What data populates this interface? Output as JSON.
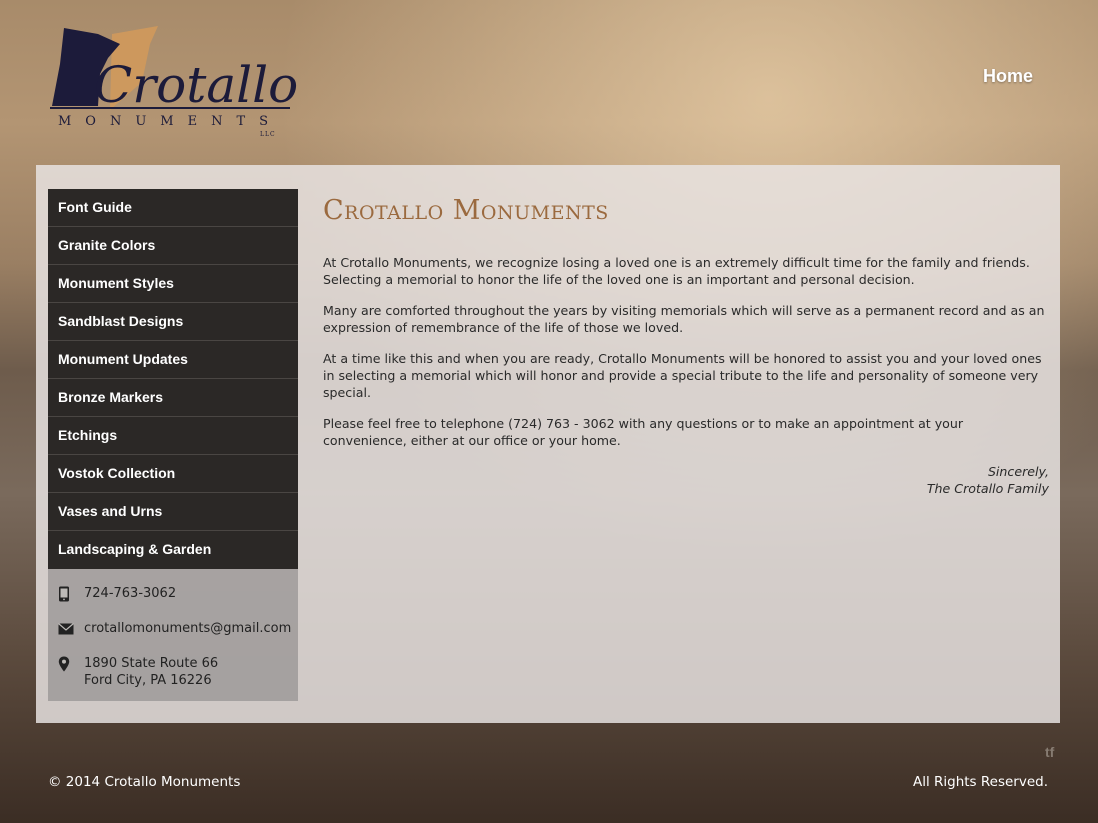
{
  "header": {
    "logo_main": "Crotallo",
    "logo_sub": "MONUMENTS",
    "logo_llc": "LLC",
    "nav_home": "Home"
  },
  "sidebar": {
    "items": [
      {
        "label": "Font Guide"
      },
      {
        "label": "Granite Colors"
      },
      {
        "label": "Monument Styles"
      },
      {
        "label": "Sandblast Designs"
      },
      {
        "label": "Monument Updates"
      },
      {
        "label": "Bronze Markers"
      },
      {
        "label": "Etchings"
      },
      {
        "label": "Vostok Collection"
      },
      {
        "label": "Vases and Urns"
      },
      {
        "label": "Landscaping & Garden"
      }
    ],
    "contact": {
      "phone": "724-763-3062",
      "email": "crotallomonuments@gmail.com",
      "address_line1": "1890 State Route 66",
      "address_line2": "Ford City, PA 16226"
    }
  },
  "main": {
    "title": "Crotallo Monuments",
    "paragraphs": [
      "At Crotallo Monuments, we recognize losing a loved one is an extremely difficult time for the family and friends. Selecting a memorial to honor the life of the loved one is an important and personal decision.",
      "Many are comforted throughout the years by visiting memorials which will serve as a permanent record and as an expression of remembrance of the life of those we loved.",
      "At a time like this and when you are ready, Crotallo Monuments will be honored to assist you and your loved ones in selecting a memorial which will honor and provide a special tribute to the life and personality of someone very special.",
      "Please feel free to telephone (724) 763 - 3062 with any questions or to make an appointment at your convenience, either at our office or your home."
    ],
    "signoff_line1": "Sincerely,",
    "signoff_line2": "The Crotallo Family"
  },
  "footer": {
    "copyright": "© 2014 Crotallo Monuments",
    "rights": "All Rights Reserved.",
    "badge": "tf"
  },
  "icons": {
    "phone": "phone-icon",
    "email": "envelope-icon",
    "address": "map-pin-icon"
  },
  "colors": {
    "accent_title": "#9b6a3f",
    "nav_bg": "#2b2826",
    "logo_navy": "#1c1b3a",
    "logo_gold": "#d29a5a"
  }
}
